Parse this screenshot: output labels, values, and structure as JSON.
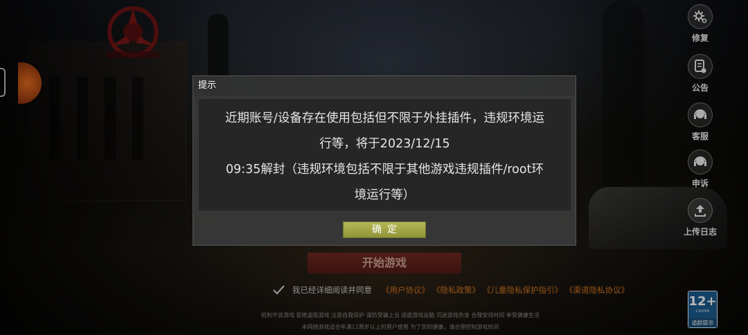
{
  "right_menu": [
    {
      "label": "修复",
      "icon": "gear-icon"
    },
    {
      "label": "公告",
      "icon": "notice-icon"
    },
    {
      "label": "客服",
      "icon": "headset-icon"
    },
    {
      "label": "申诉",
      "icon": "headset-icon"
    },
    {
      "label": "上传日志",
      "icon": "upload-icon"
    }
  ],
  "start_button": "开始游戏",
  "agreement": {
    "text": "我已经详细阅读并同意",
    "links": [
      "《用户协议》",
      "《隐私政策》",
      "《儿童隐私保护指引》",
      "《渠道隐私协议》"
    ]
  },
  "footer": {
    "line1": "抵制不良游戏  拒绝盗版游戏  注意自我保护  谨防受骗上当  适度游戏益脑  沉迷游戏伤身  合理安排时间  享受健康生活",
    "line2": "本网络游戏适合年满12周岁以上的用户使用    为了您的健康，请合理控制游戏时间"
  },
  "age_badge": {
    "rating": "12+",
    "org": "CADPA",
    "tip": "适龄提示"
  },
  "dialog": {
    "title": "提示",
    "message_lines": [
      "近期账号/设备存在使用包括但不限于外挂插件，违规环境运",
      "行等，将于2023/12/15",
      "09:35解封（违规环境包括不限于其他游戏违规插件/root环",
      "境运行等）"
    ],
    "ok_label": "确定"
  },
  "colors": {
    "link": "#d0731f",
    "ok_button": "#a5a84a",
    "dialog_bg": "#3a3a3a",
    "age_badge": "#1c5a8e"
  }
}
